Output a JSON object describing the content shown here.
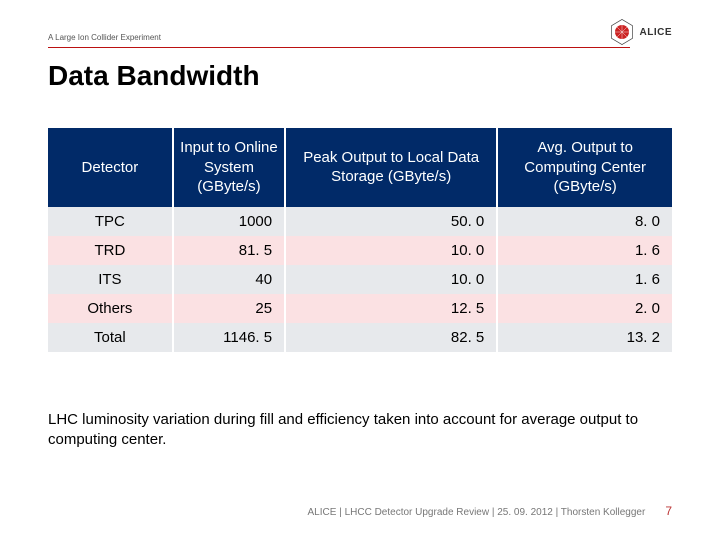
{
  "header": {
    "subtitle": "A Large Ion Collider Experiment",
    "logo_text": "ALICE"
  },
  "title": "Data Bandwidth",
  "table": {
    "headers": [
      "Detector",
      "Input to Online System (GByte/s)",
      "Peak Output to Local Data Storage (GByte/s)",
      "Avg. Output to Computing Center (GByte/s)"
    ],
    "rows": [
      {
        "detector": "TPC",
        "input": "1000",
        "peak": "50. 0",
        "avg": "8. 0"
      },
      {
        "detector": "TRD",
        "input": "81. 5",
        "peak": "10. 0",
        "avg": "1. 6"
      },
      {
        "detector": "ITS",
        "input": "40",
        "peak": "10. 0",
        "avg": "1. 6"
      },
      {
        "detector": "Others",
        "input": "25",
        "peak": "12. 5",
        "avg": "2. 0"
      },
      {
        "detector": "Total",
        "input": "1146. 5",
        "peak": "82. 5",
        "avg": "13. 2"
      }
    ]
  },
  "caption": "LHC luminosity variation during fill and efficiency taken into account for average output to computing center.",
  "footer": {
    "text": "ALICE |  LHCC Detector Upgrade Review | 25. 09. 2012 | Thorsten Kollegger",
    "page": "7"
  },
  "chart_data": {
    "type": "table",
    "title": "Data Bandwidth",
    "columns": [
      "Detector",
      "Input to Online System (GByte/s)",
      "Peak Output to Local Data Storage (GByte/s)",
      "Avg. Output to Computing Center (GByte/s)"
    ],
    "rows": [
      [
        "TPC",
        1000,
        50.0,
        8.0
      ],
      [
        "TRD",
        81.5,
        10.0,
        1.6
      ],
      [
        "ITS",
        40,
        10.0,
        1.6
      ],
      [
        "Others",
        25,
        12.5,
        2.0
      ],
      [
        "Total",
        1146.5,
        82.5,
        13.2
      ]
    ]
  }
}
